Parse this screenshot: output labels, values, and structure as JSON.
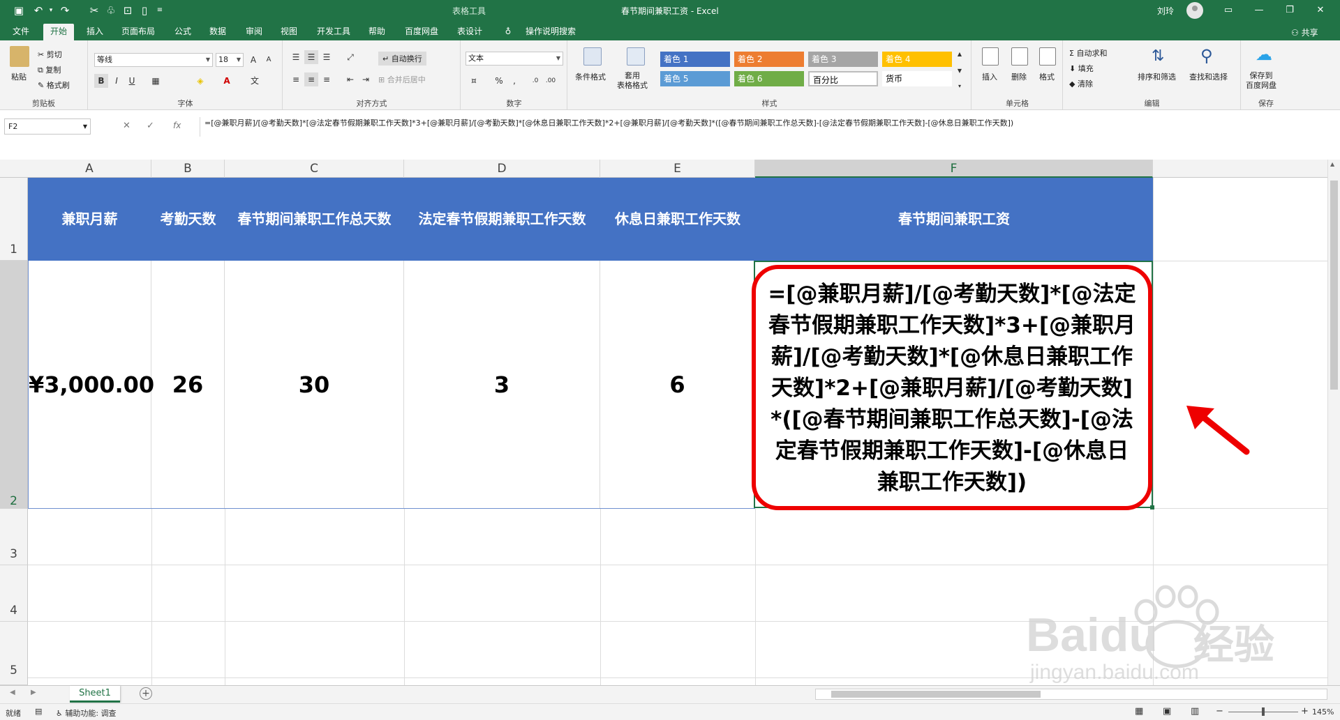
{
  "titlebar": {
    "context_tab": "表格工具",
    "title": "春节期间兼职工资 - Excel",
    "user": "刘玲",
    "icons": [
      "save-icon",
      "undo-icon",
      "redo-icon",
      "cut-icon",
      "format-painter-icon",
      "save-as-icon",
      "new-icon",
      "customize-icon"
    ],
    "window_buttons": [
      "ribbon-display-icon",
      "minimize-icon",
      "restore-icon",
      "close-icon"
    ]
  },
  "tabs": [
    "文件",
    "开始",
    "插入",
    "页面布局",
    "公式",
    "数据",
    "审阅",
    "视图",
    "开发工具",
    "帮助",
    "百度网盘",
    "表设计"
  ],
  "tell_me": "操作说明搜索",
  "share": "共享",
  "ribbon": {
    "clipboard": {
      "paste": "粘贴",
      "cut": "剪切",
      "copy": "复制",
      "painter": "格式刷",
      "label": "剪贴板"
    },
    "font": {
      "name": "等线",
      "size": "18",
      "bold": "B",
      "italic": "I",
      "underline": "U",
      "label": "字体"
    },
    "alignment": {
      "wrap": "自动换行",
      "merge": "合并后居中",
      "label": "对齐方式"
    },
    "number": {
      "format": "文本",
      "percent": "%",
      "comma": ",",
      "label": "数字"
    },
    "styles_btn": {
      "conditional": "条件格式",
      "table": "套用\n表格格式",
      "label": "样式"
    },
    "styles": [
      {
        "name": "着色 1",
        "color": "#4472c4"
      },
      {
        "name": "着色 2",
        "color": "#ed7d31"
      },
      {
        "name": "着色 3",
        "color": "#a5a5a5"
      },
      {
        "name": "着色 4",
        "color": "#ffc000"
      },
      {
        "name": "着色 5",
        "color": "#5b9bd5"
      },
      {
        "name": "着色 6",
        "color": "#70ad47"
      },
      {
        "name": "百分比",
        "color": "#ffffff"
      },
      {
        "name": "货币",
        "color": "#ffffff"
      }
    ],
    "cells": {
      "insert": "插入",
      "delete": "删除",
      "format": "格式",
      "label": "单元格"
    },
    "editing": {
      "autosum": "自动求和",
      "fill": "填充",
      "clear": "清除",
      "sort": "排序和筛选",
      "find": "查找和选择",
      "label": "编辑"
    },
    "save": {
      "btn": "保存到\n百度网盘",
      "label": "保存"
    }
  },
  "formula_bar": {
    "name_box": "F2",
    "fx": "fx",
    "formula": "=[@兼职月薪]/[@考勤天数]*[@法定春节假期兼职工作天数]*3+[@兼职月薪]/[@考勤天数]*[@休息日兼职工作天数]*2+[@兼职月薪]/[@考勤天数]*([@春节期间兼职工作总天数]-[@法定春节假期兼职工作天数]-[@休息日兼职工作天数])"
  },
  "grid": {
    "columns": [
      "A",
      "B",
      "C",
      "D",
      "E",
      "F"
    ],
    "rows": [
      "1",
      "2",
      "3",
      "4",
      "5"
    ],
    "headers": [
      "兼职月薪",
      "考勤天数",
      "春节期间兼职工作总天数",
      "法定春节假期兼职工作天数",
      "休息日兼职工作天数",
      "春节期间兼职工资"
    ],
    "row2": [
      "¥3,000.00",
      "26",
      "30",
      "3",
      "6"
    ],
    "f2_display": "=[@兼职月薪]/[@考勤天数]*[@法定春节假期兼职工作天数]*3+[@兼职月薪]/[@考勤天数]*[@休息日兼职工作天数]*2+[@兼职月薪]/[@考勤天数]*([@春节期间兼职工作总天数]-[@法定春节假期兼职工作天数]-[@休息日兼职工作天数])",
    "header_color": "#4472c4",
    "highlight_color": "#ee0000"
  },
  "sheets": [
    "Sheet1"
  ],
  "status": {
    "ready": "就绪",
    "accessibility": "辅助功能: 调查",
    "zoom": "145%"
  },
  "watermark": {
    "brand": "Baidu",
    "cn": "经验",
    "url": "jingyan.baidu.com"
  }
}
